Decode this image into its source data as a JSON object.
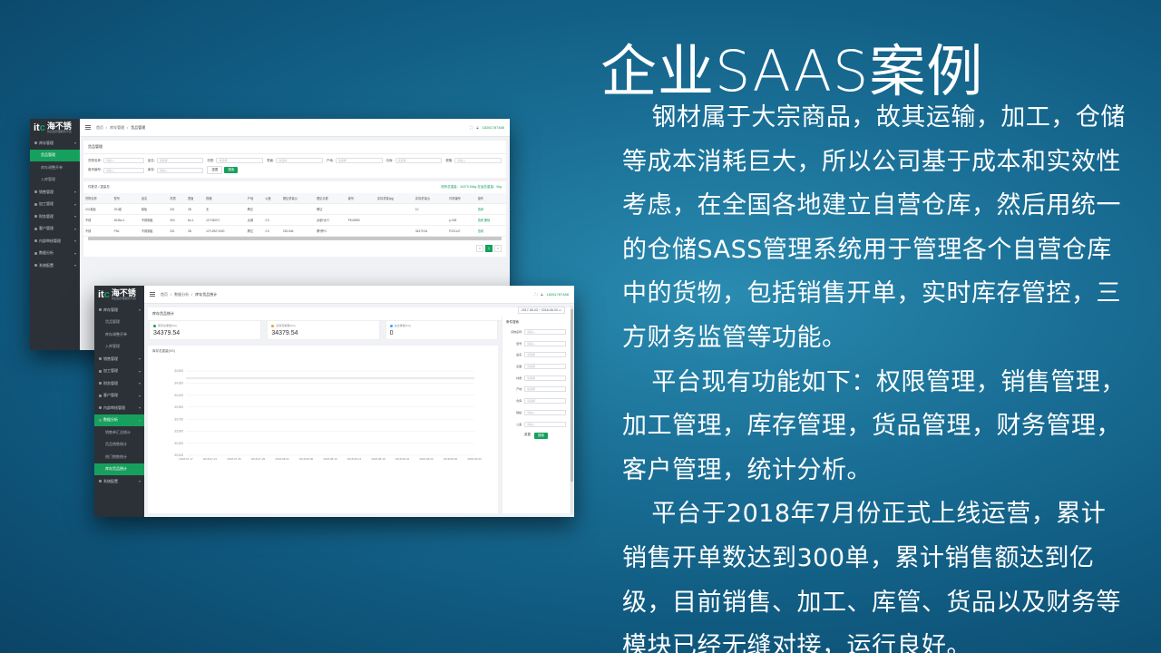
{
  "slide": {
    "title": "企业SAAS案例",
    "paragraphs": [
      "钢材属于大宗商品，故其运输，加工，仓储等成本消耗巨大，所以公司基于成本和实效性考虑，在全国各地建立自营仓库，然后用统一的仓储SASS管理系统用于管理各个自营仓库中的货物，包括销售开单，实时库存管控，三方财务监管等功能。",
      "平台现有功能如下：权限管理，销售管理，加工管理，库存管理，货品管理，财务管理，客户管理，统计分析。",
      "平台于2018年7月份正式上线运营，累计销售开单数达到300单，累计销售额达到亿级，目前销售、加工、库管、货品以及财务等模块已经无缝对接，运行良好。"
    ]
  },
  "screenshot1": {
    "logo": {
      "mark_a": "it",
      "mark_b": "c",
      "text": "海不锈",
      "sub": "供应链管理服务平台"
    },
    "sidebar": [
      {
        "label": "库存管理",
        "sub": false,
        "active": false
      },
      {
        "label": "货品管理",
        "sub": true,
        "active": true
      },
      {
        "label": "库存调整开单",
        "sub": true,
        "active": false
      },
      {
        "label": "入库管理",
        "sub": true,
        "active": false
      },
      {
        "label": "销售管理",
        "sub": false,
        "active": false
      },
      {
        "label": "加工管理",
        "sub": false,
        "active": false
      },
      {
        "label": "财务管理",
        "sub": false,
        "active": false
      },
      {
        "label": "客户管理",
        "sub": false,
        "active": false
      },
      {
        "label": "内部审核管理",
        "sub": false,
        "active": false
      },
      {
        "label": "数据分析",
        "sub": false,
        "active": false
      },
      {
        "label": "系统配置",
        "sub": false,
        "active": false
      }
    ],
    "breadcrumb": [
      "首页",
      "库存管理",
      "货品管理"
    ],
    "user": "18261787488",
    "card_title": "货品管理",
    "filters": [
      {
        "label": "货物名称:",
        "placeholder": "请输入"
      },
      {
        "label": "品名:",
        "placeholder": "请选择"
      },
      {
        "label": "材质:",
        "placeholder": "请选择"
      },
      {
        "label": "表面:",
        "placeholder": "请选择"
      },
      {
        "label": "产地:",
        "placeholder": "请选择"
      },
      {
        "label": "仓库:",
        "placeholder": "请选择"
      },
      {
        "label": "规格:",
        "placeholder": "请输入"
      },
      {
        "label": "卷号编号:",
        "placeholder": "请输入"
      },
      {
        "label": "库存:",
        "placeholder": "请输入"
      }
    ],
    "reset_label": "重置",
    "search_label": "搜索",
    "list_title": "件数总 / 重量总",
    "list_stats": "现有总重量：34379.54kg  在途总重量：0kg",
    "columns": [
      "货物名称",
      "型号",
      "品名",
      "材质",
      "表面",
      "规格",
      "产地",
      "公差",
      "理论重量(t)",
      "理论片数",
      "卷号",
      "实际重量(kg)",
      "实际重量(t)",
      "件重编号",
      "操作"
    ],
    "rows": [
      [
        "201卷板",
        "201卷",
        "卷板",
        "201",
        "2B",
        "无",
        "腾达",
        "",
        "",
        "腾达",
        "",
        "",
        "10",
        "",
        "查看"
      ],
      [
        "不锈",
        "304No.1",
        "不锈钢板",
        "304",
        "No.1",
        "12*1500*C",
        "太钢",
        "2.5",
        "",
        "太钢*太*C",
        "PK40950",
        "",
        "",
        "p-005",
        "查看 删除"
      ],
      [
        "不锈",
        "PN1",
        "不锈钢板",
        "201",
        "2B",
        "12*1250*1000",
        "腾达",
        "2.5",
        "225.546",
        "腾*腾*C",
        "",
        "",
        "34379.54",
        "P221147",
        "查看"
      ]
    ],
    "pager": [
      "<",
      "1",
      ">"
    ]
  },
  "screenshot2": {
    "logo": {
      "mark_a": "it",
      "mark_b": "c",
      "text": "海不锈",
      "sub": "供应链管理服务平台"
    },
    "sidebar": [
      {
        "label": "库存管理",
        "sub": false,
        "active": false
      },
      {
        "label": "货品管理",
        "sub": true,
        "active": false
      },
      {
        "label": "库存调整开单",
        "sub": true,
        "active": false
      },
      {
        "label": "入库管理",
        "sub": true,
        "active": false
      },
      {
        "label": "销售管理",
        "sub": false,
        "active": false
      },
      {
        "label": "加工管理",
        "sub": false,
        "active": false
      },
      {
        "label": "财务管理",
        "sub": false,
        "active": false
      },
      {
        "label": "客户管理",
        "sub": false,
        "active": false
      },
      {
        "label": "内部审核管理",
        "sub": false,
        "active": false
      },
      {
        "label": "数据分析",
        "sub": false,
        "active": true
      },
      {
        "label": "销售单汇总统计",
        "sub": true,
        "active": false
      },
      {
        "label": "货品销售统计",
        "sub": true,
        "active": false
      },
      {
        "label": "热门销售统计",
        "sub": true,
        "active": false
      },
      {
        "label": "库存货品统计",
        "sub": true,
        "active": true
      },
      {
        "label": "系统配置",
        "sub": false,
        "active": false
      }
    ],
    "breadcrumb": [
      "首页",
      "数据分析",
      "库存货品统计"
    ],
    "user": "18261787488",
    "card_title": "库存货品统计",
    "date_range": "2017-06-03 ~ 2018-06-03",
    "stats": [
      {
        "label": "库存总重量(KG)",
        "value": "34379.54",
        "color": "#17a05d"
      },
      {
        "label": "实库存重量(KG)",
        "value": "34379.54",
        "color": "#e6a23c"
      },
      {
        "label": "在途重量(KG)",
        "value": "0",
        "color": "#409eff"
      }
    ],
    "chart_title": "库存总重量(KG)",
    "filter_title": "条件搜索",
    "filter_rows": [
      {
        "label": "货物名称:",
        "placeholder": "请输入"
      },
      {
        "label": "型号:",
        "placeholder": "请输入"
      },
      {
        "label": "品名:",
        "placeholder": "请选择"
      },
      {
        "label": "表面:",
        "placeholder": "请选择"
      },
      {
        "label": "材质:",
        "placeholder": "请选择"
      },
      {
        "label": "产地:",
        "placeholder": "请选择"
      },
      {
        "label": "仓库:",
        "placeholder": "请选择"
      },
      {
        "label": "规格:",
        "placeholder": "请输入"
      },
      {
        "label": "公差:",
        "placeholder": "请输入"
      }
    ],
    "reset_label": "重置",
    "search_label": "搜索"
  },
  "chart_data": {
    "type": "line",
    "title": "库存总重量(KG)",
    "x": [
      "2018-07-17",
      "2018-07-21",
      "2018-07-25",
      "2018-07-29",
      "2018-08-02",
      "2018-08-06",
      "2018-08-10",
      "2018-08-14",
      "2018-08-18",
      "2018-08-22",
      "2018-08-26",
      "2018-08-30",
      "2018-09-03"
    ],
    "series": [
      {
        "values": [
          34379.54,
          34379.54,
          34379.54,
          34379.54,
          34379.54,
          34379.54,
          34379.54,
          34379.54,
          34379.54,
          34379.54,
          34379.54,
          34379.54,
          34379.54
        ]
      }
    ],
    "yticks": [
      "34,500",
      "34,300",
      "34,100",
      "33,900",
      "33,700",
      "33,500",
      "33,300",
      "33,100"
    ],
    "ylim": [
      33100,
      34500
    ],
    "color": "#c0c4cc",
    "grid": true
  }
}
